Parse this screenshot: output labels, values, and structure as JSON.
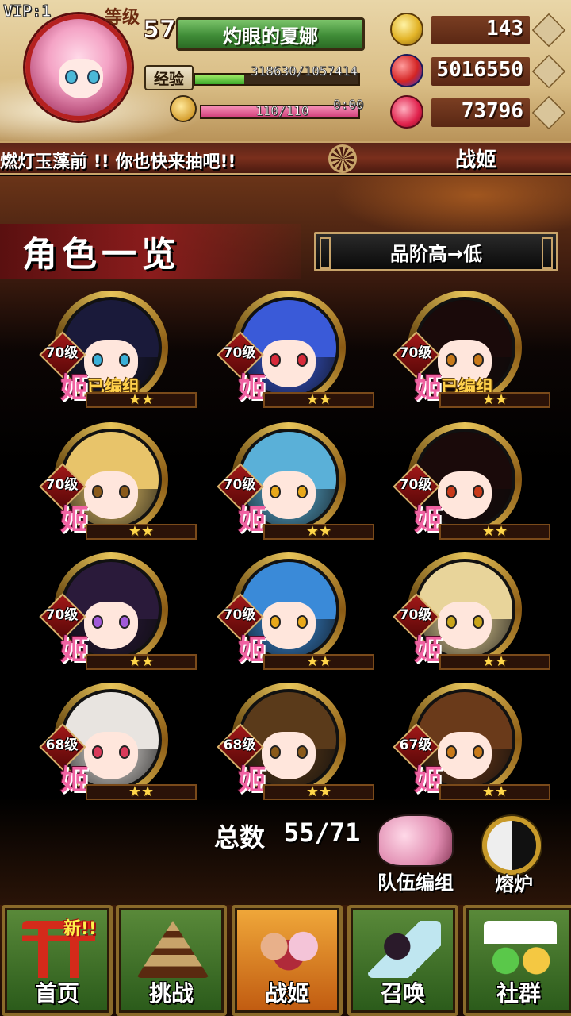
{
  "status": {
    "vip": "VIP:1",
    "level_label": "等级",
    "level": "57",
    "player_name": "灼眼的夏娜",
    "exp_label": "经验",
    "exp_text": "318630/1057414",
    "exp_fraction": 0.301,
    "stamina_text": "110/110",
    "stamina_fraction": 1.0,
    "timer": "0:00",
    "coins": "143",
    "gems": "5016550",
    "hearts": "73796"
  },
  "ticker": {
    "message": "燃灯玉藻前 !! 你也快来抽吧!!",
    "section_title": "战姬"
  },
  "page": {
    "title": "角色一览",
    "sort_label": "品阶高→低"
  },
  "characters": [
    {
      "level": "70级",
      "hime": "姬",
      "tag": "已编组",
      "stars": "★★",
      "hair": "#1a1a3a",
      "eyes": "#3ab0d8"
    },
    {
      "level": "70级",
      "hime": "姬",
      "tag": "",
      "stars": "★★",
      "hair": "#3a5ad8",
      "eyes": "#d82a3a"
    },
    {
      "level": "70级",
      "hime": "姬",
      "tag": "已编组",
      "stars": "★★",
      "hair": "#1a0a0a",
      "eyes": "#c87a1a"
    },
    {
      "level": "70级",
      "hime": "姬",
      "tag": "",
      "stars": "★★",
      "hair": "#e8c46a",
      "eyes": "#8a5a1a"
    },
    {
      "level": "70级",
      "hime": "姬",
      "tag": "",
      "stars": "★★",
      "hair": "#5ab0d8",
      "eyes": "#e8a81a"
    },
    {
      "level": "70级",
      "hime": "姬",
      "tag": "",
      "stars": "★★",
      "hair": "#1a0a0a",
      "eyes": "#c83a1a"
    },
    {
      "level": "70级",
      "hime": "姬",
      "tag": "",
      "stars": "★★",
      "hair": "#2a1a3a",
      "eyes": "#a05ad8"
    },
    {
      "level": "70级",
      "hime": "姬",
      "tag": "",
      "stars": "★★",
      "hair": "#3a8ad8",
      "eyes": "#e8a81a"
    },
    {
      "level": "70级",
      "hime": "姬",
      "tag": "",
      "stars": "★★",
      "hair": "#e8d49a",
      "eyes": "#c8a41a"
    },
    {
      "level": "68级",
      "hime": "姬",
      "tag": "",
      "stars": "★★",
      "hair": "#e8e4e0",
      "eyes": "#d83a5a"
    },
    {
      "level": "68级",
      "hime": "姬",
      "tag": "",
      "stars": "★★",
      "hair": "#5a3a1a",
      "eyes": "#8a5a1a"
    },
    {
      "level": "67级",
      "hime": "姬",
      "tag": "",
      "stars": "★★",
      "hair": "#6a3a1a",
      "eyes": "#c87a1a"
    }
  ],
  "summary": {
    "total_label": "总数",
    "total_value": "55/71",
    "team_label": "队伍编组",
    "furnace_label": "熔炉"
  },
  "nav": [
    {
      "label": "首页",
      "new_badge": "新!!",
      "icon": "torii-icon"
    },
    {
      "label": "挑战",
      "new_badge": "",
      "icon": "pagoda-icon"
    },
    {
      "label": "战姬",
      "new_badge": "",
      "icon": "girls-icon"
    },
    {
      "label": "召唤",
      "new_badge": "",
      "icon": "summon-icon"
    },
    {
      "label": "社群",
      "new_badge": "",
      "icon": "chat-icon"
    }
  ],
  "colors": {
    "accent_gold": "#c8a46a",
    "hime_pink": "#f062a2",
    "nav_green": "#2a5a1a",
    "nav_active": "#c05a10"
  }
}
